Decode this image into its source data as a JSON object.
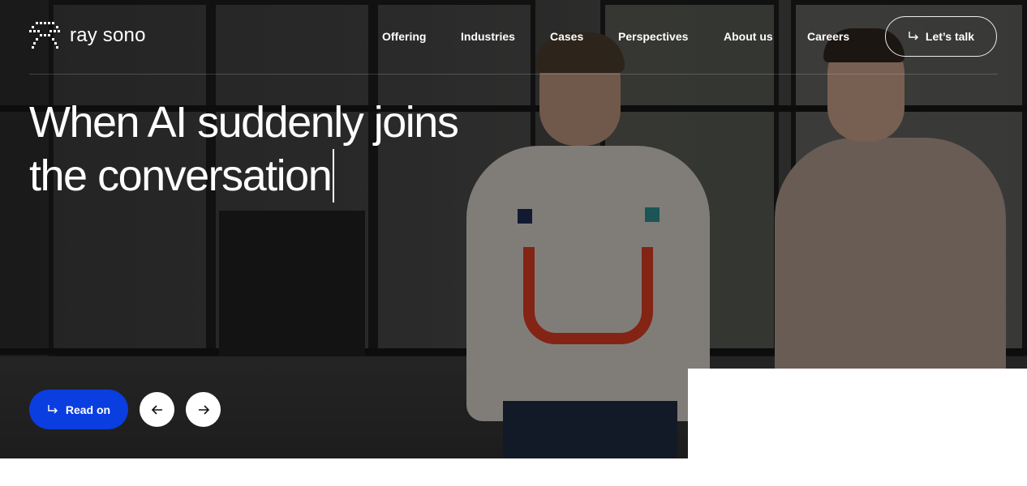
{
  "brand": {
    "name": "ray sono",
    "logo_icon": "ray-sono-logo-icon"
  },
  "nav": {
    "items": [
      {
        "label": "Offering"
      },
      {
        "label": "Industries"
      },
      {
        "label": "Cases"
      },
      {
        "label": "Perspectives"
      },
      {
        "label": "About us"
      },
      {
        "label": "Careers"
      }
    ],
    "cta_label": "Let’s talk",
    "cta_icon": "arrow-turn-down-right-icon"
  },
  "hero": {
    "headline_line1": "When AI suddenly joins",
    "headline_line2": "the conversation",
    "read_on_label": "Read on",
    "read_on_icon": "arrow-turn-down-right-icon",
    "prev_icon": "arrow-left-icon",
    "next_icon": "arrow-right-icon"
  },
  "colors": {
    "primary_button": "#0a3ee0",
    "text": "#ffffff",
    "page_background": "#ffffff"
  }
}
